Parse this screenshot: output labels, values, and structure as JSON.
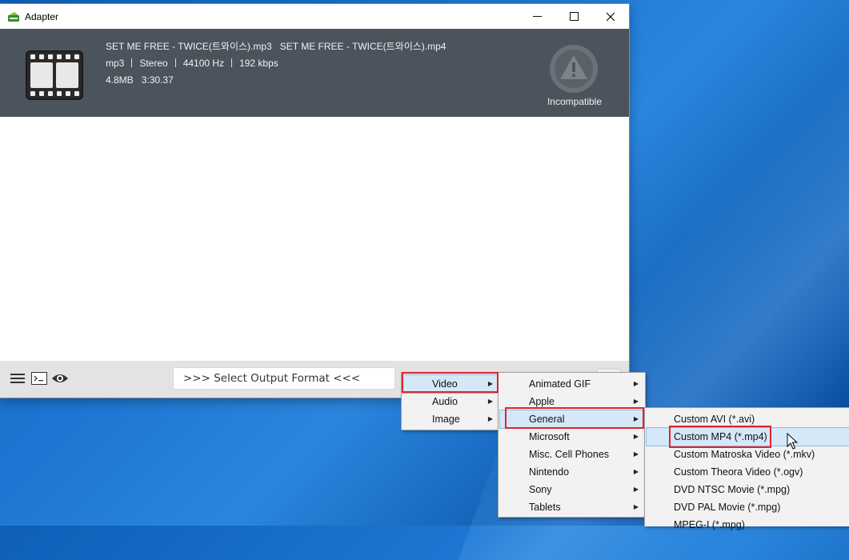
{
  "window": {
    "title": "Adapter",
    "minimize": "—",
    "maximize": "☐",
    "close": "✕"
  },
  "file": {
    "input_name": "SET ME FREE - TWICE(트와이스).mp3",
    "output_name": "SET ME FREE - TWICE(트와이스).mp4",
    "format": "mp3",
    "channels": "Stereo",
    "sample_rate": "44100 Hz",
    "bitrate": "192 kbps",
    "size": "4.8MB",
    "duration": "3:30.37",
    "status": "Incompatible"
  },
  "bottombar": {
    "format_placeholder": ">>> Select Output Format <<<"
  },
  "menu_level1": [
    {
      "label": "Video"
    },
    {
      "label": "Audio"
    },
    {
      "label": "Image"
    }
  ],
  "menu_level2": [
    {
      "label": "Animated GIF"
    },
    {
      "label": "Apple"
    },
    {
      "label": "General"
    },
    {
      "label": "Microsoft"
    },
    {
      "label": "Misc. Cell Phones"
    },
    {
      "label": "Nintendo"
    },
    {
      "label": "Sony"
    },
    {
      "label": "Tablets"
    }
  ],
  "menu_level3": [
    {
      "label": "Custom AVI (*.avi)"
    },
    {
      "label": "Custom MP4 (*.mp4)"
    },
    {
      "label": "Custom Matroska Video (*.mkv)"
    },
    {
      "label": "Custom Theora Video (*.ogv)"
    },
    {
      "label": "DVD NTSC Movie (*.mpg)"
    },
    {
      "label": "DVD PAL Movie (*.mpg)"
    },
    {
      "label": "MPEG-I (*.mpg)"
    }
  ],
  "colors": {
    "panel": "#4b535c",
    "highlight": "#d5e8f8",
    "annotation": "#e0242c"
  }
}
